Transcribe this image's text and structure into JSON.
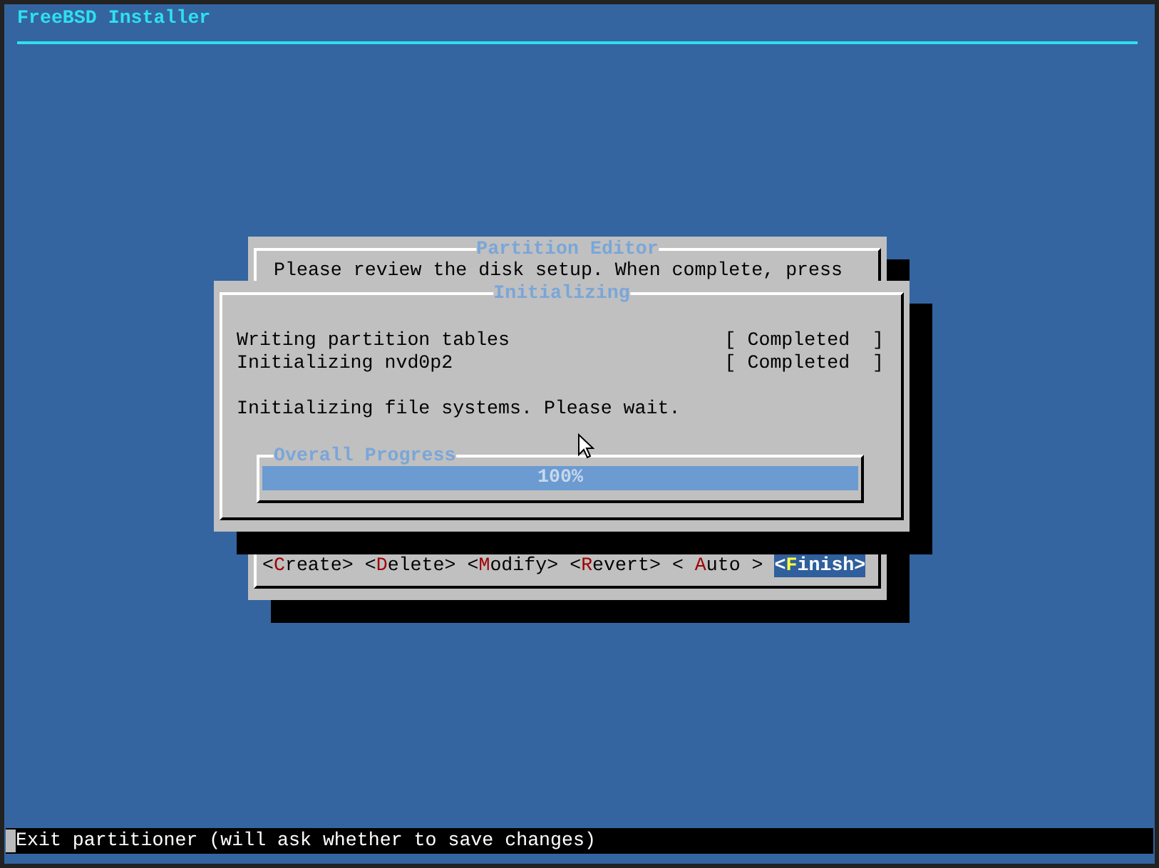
{
  "window": {
    "title": "FreeBSD Installer"
  },
  "partition_editor": {
    "title": "Partition Editor",
    "message": "Please review the disk setup. When complete, press",
    "buttons": [
      {
        "left": "<",
        "key": "C",
        "right": "reate>",
        "selected": false
      },
      {
        "left": "<",
        "key": "D",
        "right": "elete>",
        "selected": false
      },
      {
        "left": "<",
        "key": "M",
        "right": "odify>",
        "selected": false
      },
      {
        "left": "<",
        "key": "R",
        "right": "evert>",
        "selected": false
      },
      {
        "left": "< ",
        "key": "A",
        "right": "uto >",
        "selected": false
      },
      {
        "left": "<",
        "key": "F",
        "right": "inish>",
        "selected": true
      }
    ]
  },
  "initializing": {
    "title": "Initializing",
    "tasks": [
      {
        "name": "Writing partition tables",
        "status": "[ Completed  ]"
      },
      {
        "name": "Initializing nvd0p2",
        "status": "[ Completed  ]"
      }
    ],
    "message": "Initializing file systems. Please wait.",
    "progress": {
      "title": "Overall Progress",
      "level": 1.0,
      "reading": "100%"
    }
  },
  "status_bar": "Exit partitioner (will ask whether to save changes)"
}
